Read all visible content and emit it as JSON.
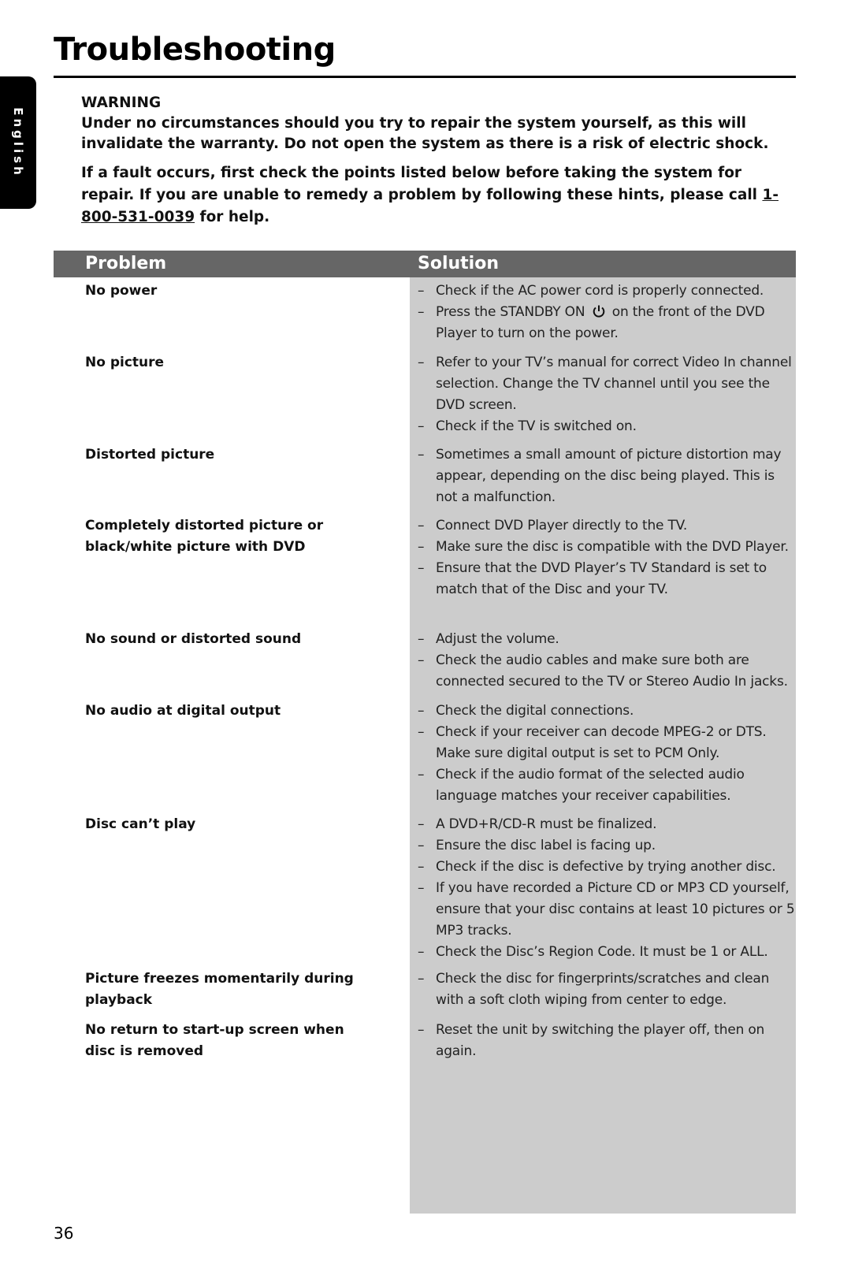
{
  "page": {
    "title": "Troubleshooting",
    "language_tab": "English",
    "page_number": "36"
  },
  "warning": {
    "heading": "WARNING",
    "text": "Under no circumstances should you try to repair the system yourself, as this will invalidate the warranty.  Do not open the system as there is a risk of electric shock.",
    "intro_before": "If a fault occurs, first check the points listed below before taking the system for repair. If you are unable to remedy a problem by following these hints, please call ",
    "phone": "1-800-531-0039",
    "intro_after": " for help."
  },
  "table": {
    "header_problem": "Problem",
    "header_solution": "Solution",
    "colors": {
      "header_bg": "#666666",
      "solution_bg": "#cccccc"
    },
    "rows": [
      {
        "problem": "No power",
        "solutions": [
          "Check if the AC power cord is properly connected.",
          "Press the STANDBY ON {power-icon} on the front of the DVD Player to turn on the power."
        ]
      },
      {
        "problem": "No picture",
        "solutions": [
          "Refer to your TV’s manual for correct Video In channel selection.  Change the TV channel until you see the DVD screen.",
          "Check if the TV is switched on."
        ]
      },
      {
        "problem": "Distorted picture",
        "solutions": [
          "Sometimes a small amount of picture distortion may appear, depending on the disc being played. This is not a malfunction."
        ]
      },
      {
        "problem": "Completely distorted picture or black/white picture with DVD",
        "solutions": [
          "Connect DVD Player directly to the TV.",
          "Make sure the disc is compatible with the DVD Player.",
          "Ensure that the DVD Player’s TV Standard is set to match that of the Disc and your TV."
        ]
      },
      {
        "problem": "No sound or distorted sound",
        "solutions": [
          "Adjust the volume.",
          "Check the audio cables and make sure both are connected secured to the TV or Stereo Audio In jacks."
        ]
      },
      {
        "problem": "No audio at digital output",
        "solutions": [
          "Check the digital connections.",
          "Check if your receiver can decode MPEG-2 or DTS. Make sure digital output is set to PCM Only.",
          "Check if the audio format of the selected audio language matches your receiver capabilities."
        ]
      },
      {
        "problem": "Disc can’t play",
        "solutions": [
          "A DVD+R/CD-R must be finalized.",
          "Ensure the disc label is facing up.",
          "Check if the disc is defective by trying another disc.",
          "If you have recorded a Picture CD or MP3 CD yourself, ensure that your disc contains at least 10 pictures or 5 MP3 tracks.",
          "Check the Disc’s Region Code. It must be 1 or ALL."
        ]
      },
      {
        "problem": "Picture freezes momentarily during playback",
        "solutions": [
          "Check the disc for fingerprints/scratches and clean with a soft cloth wiping from center to edge."
        ]
      },
      {
        "problem": "No return to start-up screen when disc is removed",
        "solutions": [
          "Reset the unit by switching the player off, then on again."
        ]
      }
    ]
  }
}
